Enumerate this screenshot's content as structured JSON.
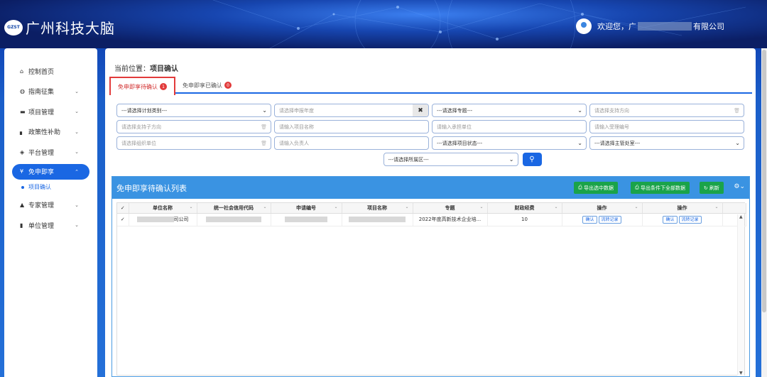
{
  "header": {
    "logo_mark": "GZST",
    "title": "广州科技大脑",
    "welcome": "欢迎您，广",
    "company_suffix": "有限公司"
  },
  "sidebar": {
    "items": [
      {
        "label": "控制首页",
        "icon": "home-icon",
        "glyph": "⌂",
        "chevron": false
      },
      {
        "label": "指南征集",
        "icon": "globe-icon",
        "glyph": "◍",
        "chevron": true
      },
      {
        "label": "项目管理",
        "icon": "folder-icon",
        "glyph": "▬",
        "chevron": true
      },
      {
        "label": "政策性补助",
        "icon": "bar-chart-icon",
        "glyph": "▖",
        "chevron": true
      },
      {
        "label": "平台管理",
        "icon": "cube-icon",
        "glyph": "◈",
        "chevron": true
      },
      {
        "label": "免申即享",
        "icon": "yen-icon",
        "glyph": "¥",
        "chevron": true,
        "active": true
      },
      {
        "label": "专家管理",
        "icon": "graduation-cap-icon",
        "glyph": "▲",
        "chevron": true
      },
      {
        "label": "单位管理",
        "icon": "building-icon",
        "glyph": "▮",
        "chevron": true
      }
    ],
    "sub_item": "项目确认"
  },
  "breadcrumb": {
    "prefix": "当前位置：",
    "current": "项目确认"
  },
  "tabs": [
    {
      "label": "免申即享待确认",
      "count": "1"
    },
    {
      "label": "免申即享已确认",
      "count": "0"
    }
  ],
  "filters": {
    "row1": [
      "---请选择计划类别---",
      "请选择申报年度",
      "---请选择专题---",
      "请选择支持方向"
    ],
    "row2": [
      "请选择支持子方向",
      "请输入项目名称",
      "请输入承担单位",
      "请输入受理编号"
    ],
    "row3": [
      "请选择组织单位",
      "请输入负责人",
      "---请选择项目状态---",
      "---请选择主管处室---"
    ],
    "region": "---请选择所属区---"
  },
  "panel": {
    "title": "免申即享待确认列表",
    "export_selected": "导出选中数据",
    "export_all": "导出条件下全部数据",
    "refresh": "刷新"
  },
  "table": {
    "columns": [
      "单位名称",
      "统一社会信用代码",
      "申请编号",
      "项目名称",
      "专题",
      "财政经费",
      "操作",
      "操作"
    ],
    "rows": [
      {
        "unit_suffix": "司公司",
        "topic": "2022年度高新技术企业培...",
        "funding": "10",
        "confirm": "确认",
        "log": "流转记录"
      }
    ]
  },
  "colors": {
    "accent": "#1a67e3",
    "header_bar": "#3a93e2",
    "green": "#1aa34a",
    "badge": "#e23b3b"
  }
}
